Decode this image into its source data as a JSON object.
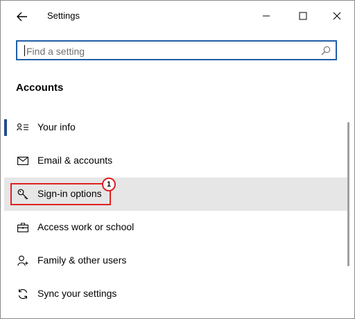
{
  "window": {
    "title": "Settings"
  },
  "search": {
    "placeholder": "Find a setting"
  },
  "section": {
    "heading": "Accounts"
  },
  "nav_items": [
    {
      "label": "Your info",
      "icon": "person-card-icon",
      "active": true
    },
    {
      "label": "Email & accounts",
      "icon": "envelope-icon"
    },
    {
      "label": "Sign-in options",
      "icon": "key-icon",
      "selected": true
    },
    {
      "label": "Access work or school",
      "icon": "briefcase-icon"
    },
    {
      "label": "Family & other users",
      "icon": "person-add-icon"
    },
    {
      "label": "Sync your settings",
      "icon": "sync-icon"
    }
  ],
  "annotation": {
    "badge_number": "1"
  },
  "colors": {
    "accent": "#1f4e8c",
    "search_border": "#1f5fa8",
    "selected_row": "#e6e6e6",
    "annotation_red": "#e02020"
  }
}
